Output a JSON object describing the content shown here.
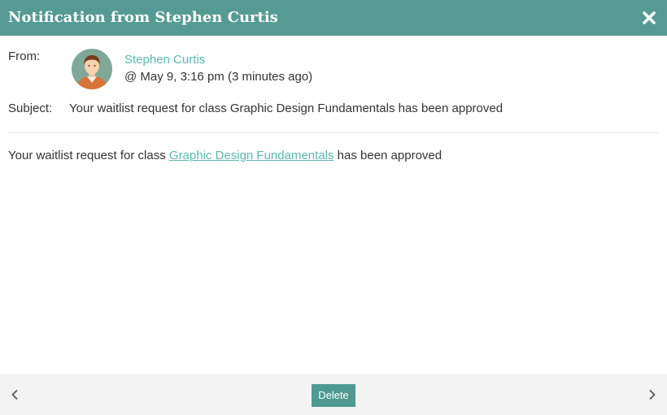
{
  "header": {
    "title": "Notification from Stephen Curtis",
    "close_icon": "close-icon"
  },
  "message": {
    "from_label": "From:",
    "sender_name": "Stephen Curtis",
    "sent_time": "@ May 9, 3:16 pm (3 minutes ago)",
    "subject_label": "Subject:",
    "subject": "Your waitlist request for class Graphic Design Fundamentals has been approved",
    "body_prefix": "Your waitlist request for class ",
    "body_link": "Graphic Design Fundamentals",
    "body_suffix": " has been approved"
  },
  "footer": {
    "delete_label": "Delete",
    "prev_icon": "chevron-left-icon",
    "next_icon": "chevron-right-icon"
  },
  "colors": {
    "header_bg": "#559b94",
    "accent_link": "#5bb8ad",
    "delete_bg": "#4e9990",
    "footer_bg": "#f3f3f3"
  }
}
